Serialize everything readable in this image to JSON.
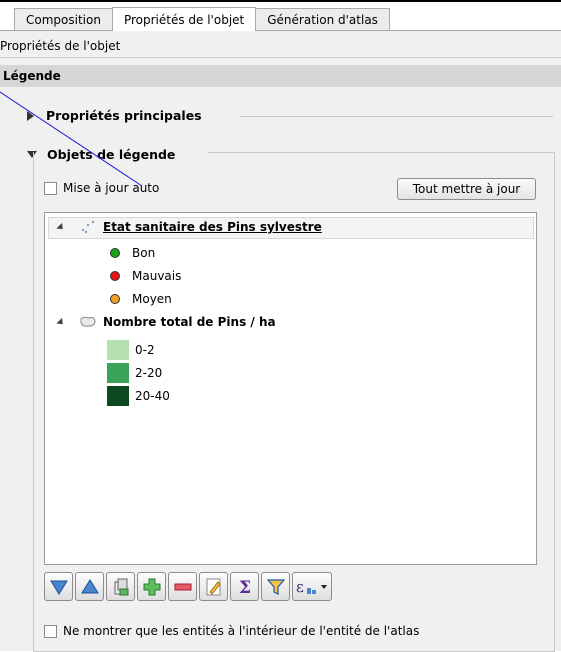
{
  "tabs": [
    {
      "label": "Composition",
      "active": false
    },
    {
      "label": "Propriétés de l'objet",
      "active": true
    },
    {
      "label": "Génération d'atlas",
      "active": false
    }
  ],
  "panel": {
    "title": "Propriétés de l'objet",
    "section": "Légende"
  },
  "groups": {
    "main_props": "Propriétés principales",
    "legend_items": "Objets de légende"
  },
  "controls": {
    "auto_update_label": "Mise à jour auto",
    "auto_update_checked": false,
    "update_all_button": "Tout mettre à jour",
    "atlas_only_label": "Ne montrer que les entités à l'intérieur de l'entité de l'atlas",
    "atlas_only_checked": false
  },
  "tree": {
    "layer1": {
      "name": "Etat sanitaire des Pins sylvestre",
      "items": [
        {
          "label": "Bon",
          "color": "#1aa31a"
        },
        {
          "label": "Mauvais",
          "color": "#e01818"
        },
        {
          "label": "Moyen",
          "color": "#f0a020"
        }
      ]
    },
    "layer2": {
      "name": "Nombre total de Pins / ha",
      "items": [
        {
          "label": "0-2",
          "color": "#b5e0b0"
        },
        {
          "label": "2-20",
          "color": "#3aa35a"
        },
        {
          "label": "20-40",
          "color": "#0a4a1e"
        }
      ]
    }
  },
  "toolbar": {
    "icons": [
      "move-down-icon",
      "move-up-icon",
      "edit-group-icon",
      "add-icon",
      "remove-icon",
      "edit-icon",
      "sum-icon",
      "filter-icon",
      "expression-icon"
    ]
  }
}
